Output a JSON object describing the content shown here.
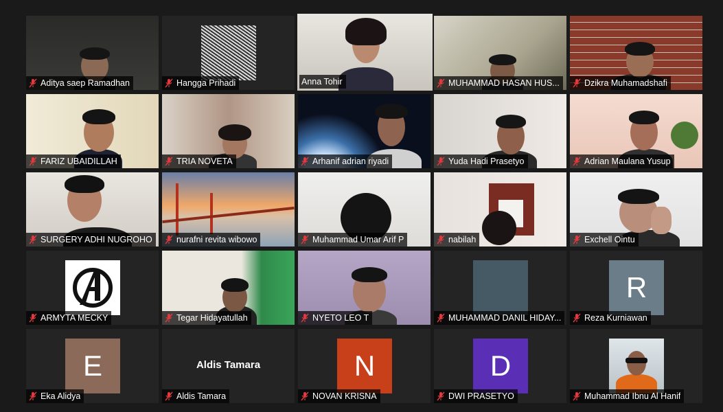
{
  "participants": [
    {
      "name": "Aditya saep Ramadhan",
      "type": "video",
      "muted": true
    },
    {
      "name": "Hangga Prihadi",
      "type": "video",
      "muted": true
    },
    {
      "name": "Anna Tohir",
      "type": "video",
      "muted": false,
      "active_speaker": true
    },
    {
      "name": "MUHAMMAD HASAN HUS...",
      "type": "video",
      "muted": true
    },
    {
      "name": "Dzikra Muhamadshafi",
      "type": "video",
      "muted": true
    },
    {
      "name": "FARIZ UBAIDILLAH",
      "type": "video",
      "muted": true
    },
    {
      "name": "TRIA NOVETA",
      "type": "video",
      "muted": true
    },
    {
      "name": "Arhanif adrian riyadi",
      "type": "video",
      "muted": true
    },
    {
      "name": "Yuda Hadi Prasetyo",
      "type": "video",
      "muted": true
    },
    {
      "name": "Adrian Maulana Yusup",
      "type": "video",
      "muted": true
    },
    {
      "name": "SURGERY ADHI NUGROHO",
      "type": "video",
      "muted": true
    },
    {
      "name": "nurafni revita wibowo",
      "type": "video",
      "muted": true
    },
    {
      "name": "Muhammad Umar Arif P",
      "type": "video",
      "muted": true
    },
    {
      "name": "nabilah",
      "type": "video",
      "muted": true
    },
    {
      "name": "Exchell Ointu",
      "type": "video",
      "muted": true
    },
    {
      "name": "ARMYTA MECKY",
      "type": "avatar-image",
      "muted": true
    },
    {
      "name": "Tegar Hidayatullah",
      "type": "video",
      "muted": true
    },
    {
      "name": "NYETO LEO T",
      "type": "video",
      "muted": true
    },
    {
      "name": "MUHAMMAD DANIL HIDAY...",
      "type": "avatar-color",
      "avatar_color": "#465a66",
      "muted": true
    },
    {
      "name": "Reza Kurniawan",
      "type": "avatar-letter",
      "letter": "R",
      "avatar_color": "#6a7d88",
      "muted": true
    },
    {
      "name": "Eka Alidya",
      "type": "avatar-letter",
      "letter": "E",
      "avatar_color": "#8c6a5a",
      "muted": true
    },
    {
      "name": "Aldis Tamara",
      "type": "name-only",
      "display_name": "Aldis Tamara",
      "muted": true
    },
    {
      "name": "NOVAN KRISNA",
      "type": "avatar-letter",
      "letter": "N",
      "avatar_color": "#c8401a",
      "muted": true
    },
    {
      "name": "DWI PRASETYO",
      "type": "avatar-letter",
      "letter": "D",
      "avatar_color": "#5a2fb5",
      "muted": true
    },
    {
      "name": "Muhammad Ibnu Al Hanif",
      "type": "avatar-image",
      "muted": true
    }
  ],
  "colors": {
    "active_speaker_border": "#8fd14f",
    "mute_icon": "#e0393e",
    "tile_bg": "#242424",
    "page_bg": "#1a1a1a"
  }
}
